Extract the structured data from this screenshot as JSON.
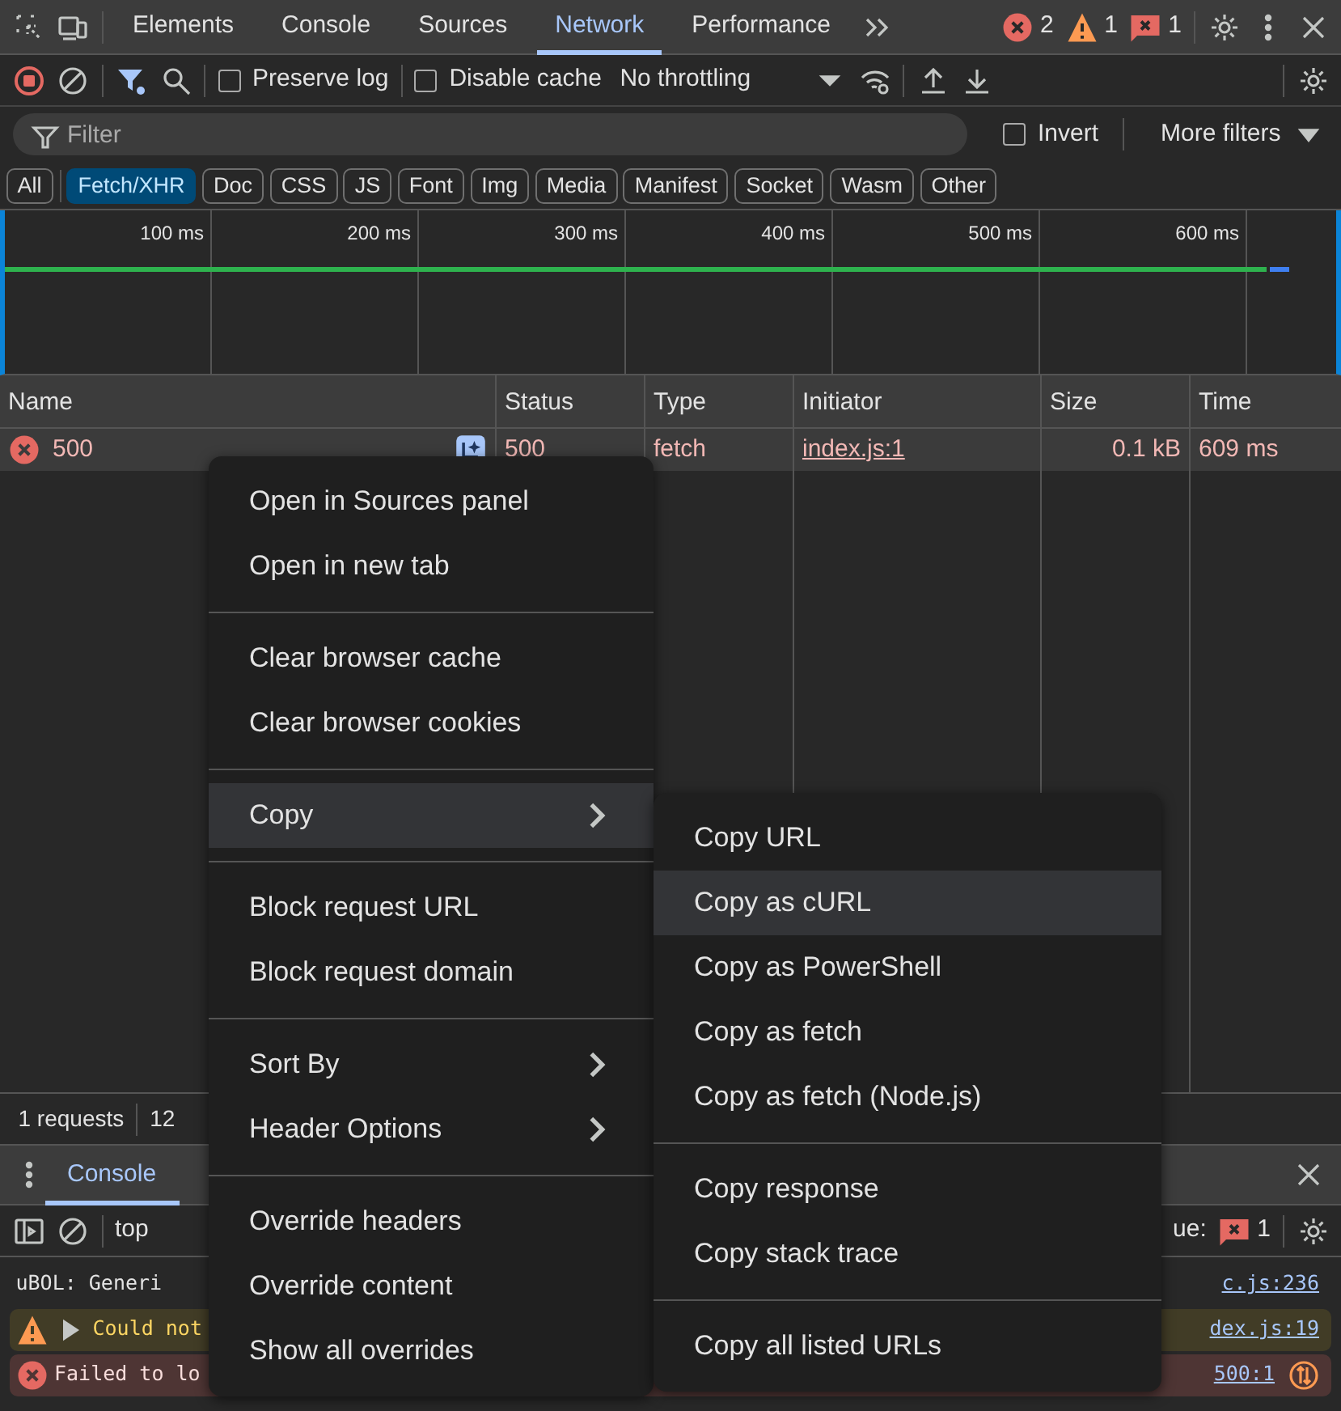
{
  "main_tabs": [
    {
      "label": "Elements",
      "selected": false
    },
    {
      "label": "Console",
      "selected": false
    },
    {
      "label": "Sources",
      "selected": false
    },
    {
      "label": "Network",
      "selected": true
    },
    {
      "label": "Performance",
      "selected": false
    }
  ],
  "issue_counts": {
    "errors": "2",
    "warnings": "1",
    "issues": "1"
  },
  "network_toolbar": {
    "recording": true,
    "preserve_log": {
      "label": "Preserve log",
      "checked": false
    },
    "disable_cache": {
      "label": "Disable cache",
      "checked": false
    },
    "throttling": "No throttling"
  },
  "filter_bar": {
    "placeholder": "Filter",
    "invert": {
      "label": "Invert",
      "checked": false
    },
    "more_filters": "More filters"
  },
  "type_filters": [
    {
      "label": "All",
      "selected": false
    },
    {
      "label": "Fetch/XHR",
      "selected": true
    },
    {
      "label": "Doc",
      "selected": false
    },
    {
      "label": "CSS",
      "selected": false
    },
    {
      "label": "JS",
      "selected": false
    },
    {
      "label": "Font",
      "selected": false
    },
    {
      "label": "Img",
      "selected": false
    },
    {
      "label": "Media",
      "selected": false
    },
    {
      "label": "Manifest",
      "selected": false
    },
    {
      "label": "Socket",
      "selected": false
    },
    {
      "label": "Wasm",
      "selected": false
    },
    {
      "label": "Other",
      "selected": false
    }
  ],
  "timeline": {
    "ticks": [
      "100 ms",
      "200 ms",
      "300 ms",
      "400 ms",
      "500 ms",
      "600 ms"
    ]
  },
  "table": {
    "columns": [
      "Name",
      "Status",
      "Type",
      "Initiator",
      "Size",
      "Time"
    ],
    "rows": [
      {
        "name": "500",
        "status": "500",
        "type": "fetch",
        "initiator": "index.js:1",
        "size": "0.1 kB",
        "time": "609 ms",
        "failed": true
      }
    ]
  },
  "status_bar": {
    "requests": "1 requests",
    "transferred": "12"
  },
  "drawer": {
    "tabs": [
      {
        "label": "Console",
        "selected": true
      }
    ],
    "context": "top",
    "issues_label": "ue:",
    "issues_count": "1",
    "messages": [
      {
        "kind": "info",
        "text": "uBOL: Generi",
        "source": "c.js:236"
      },
      {
        "kind": "warning",
        "text": "Could not",
        "source": "dex.js:19"
      },
      {
        "kind": "error",
        "text": "Failed to lo",
        "source": "500:1"
      }
    ]
  },
  "context_menu": {
    "groups": [
      [
        {
          "label": "Open in Sources panel",
          "submenu": false,
          "selected": false
        },
        {
          "label": "Open in new tab",
          "submenu": false,
          "selected": false
        }
      ],
      [
        {
          "label": "Clear browser cache",
          "submenu": false,
          "selected": false
        },
        {
          "label": "Clear browser cookies",
          "submenu": false,
          "selected": false
        }
      ],
      [
        {
          "label": "Copy",
          "submenu": true,
          "selected": true
        }
      ],
      [
        {
          "label": "Block request URL",
          "submenu": false,
          "selected": false
        },
        {
          "label": "Block request domain",
          "submenu": false,
          "selected": false
        }
      ],
      [
        {
          "label": "Sort By",
          "submenu": true,
          "selected": false
        },
        {
          "label": "Header Options",
          "submenu": true,
          "selected": false
        }
      ],
      [
        {
          "label": "Override headers",
          "submenu": false,
          "selected": false
        },
        {
          "label": "Override content",
          "submenu": false,
          "selected": false
        },
        {
          "label": "Show all overrides",
          "submenu": false,
          "selected": false
        }
      ]
    ]
  },
  "copy_submenu": {
    "groups": [
      [
        {
          "label": "Copy URL",
          "selected": false
        },
        {
          "label": "Copy as cURL",
          "selected": true
        },
        {
          "label": "Copy as PowerShell",
          "selected": false
        },
        {
          "label": "Copy as fetch",
          "selected": false
        },
        {
          "label": "Copy as fetch (Node.js)",
          "selected": false
        }
      ],
      [
        {
          "label": "Copy response",
          "selected": false
        },
        {
          "label": "Copy stack trace",
          "selected": false
        }
      ],
      [
        {
          "label": "Copy all listed URLs",
          "selected": false
        }
      ]
    ]
  }
}
